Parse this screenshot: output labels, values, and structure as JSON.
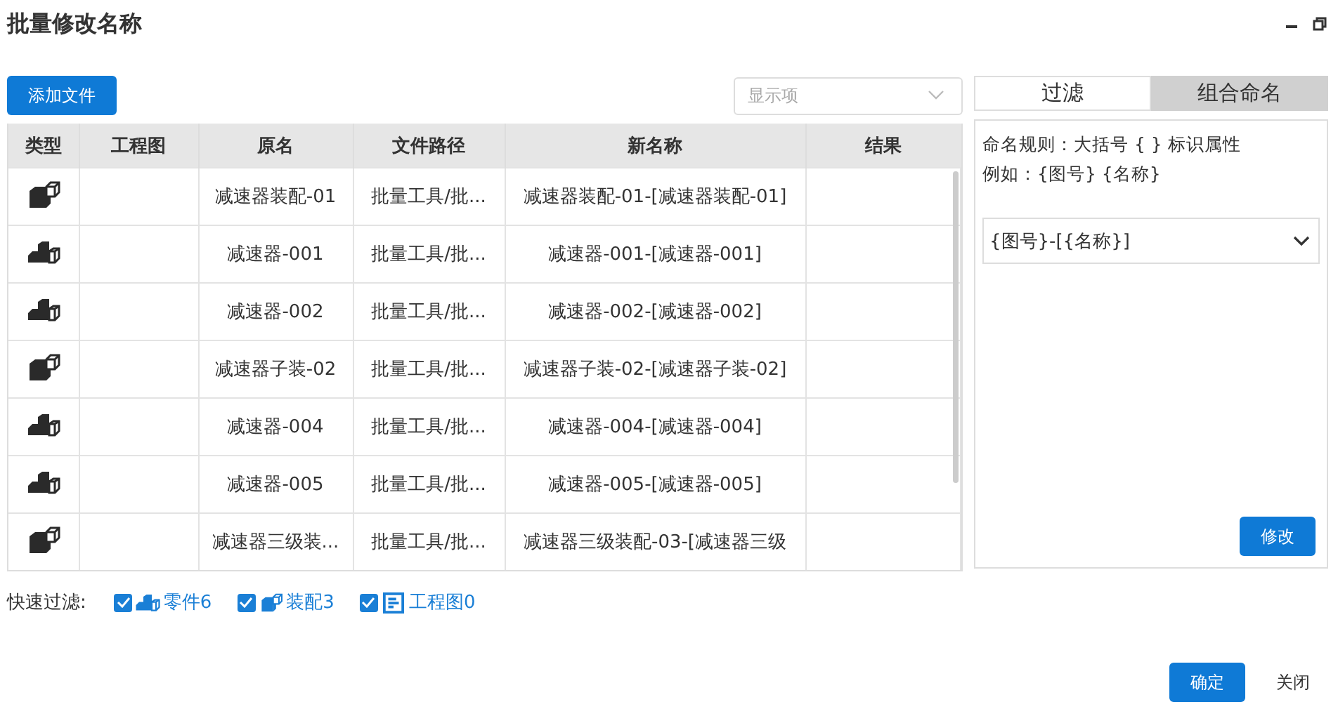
{
  "window": {
    "title": "批量修改名称"
  },
  "add_button": "添加文件",
  "display_select": {
    "placeholder": "显示项"
  },
  "table": {
    "columns": [
      "类型",
      "工程图",
      "原名",
      "文件路径",
      "新名称",
      "结果"
    ],
    "rows": [
      {
        "kind": "assembly",
        "original_name": "减速器装配-01",
        "path": "批量工具/批...",
        "new_name": "减速器装配-01-[减速器装配-01]"
      },
      {
        "kind": "part",
        "original_name": "减速器-001",
        "path": "批量工具/批...",
        "new_name": "减速器-001-[减速器-001]"
      },
      {
        "kind": "part",
        "original_name": "减速器-002",
        "path": "批量工具/批...",
        "new_name": "减速器-002-[减速器-002]"
      },
      {
        "kind": "assembly",
        "original_name": "减速器子装-02",
        "path": "批量工具/批...",
        "new_name": "减速器子装-02-[减速器子装-02]"
      },
      {
        "kind": "part",
        "original_name": "减速器-004",
        "path": "批量工具/批...",
        "new_name": "减速器-004-[减速器-004]"
      },
      {
        "kind": "part",
        "original_name": "减速器-005",
        "path": "批量工具/批...",
        "new_name": "减速器-005-[减速器-005]"
      },
      {
        "kind": "assembly",
        "original_name": "减速器三级装...",
        "path": "批量工具/批...",
        "new_name": "减速器三级装配-03-[减速器三级"
      }
    ]
  },
  "quick_filter": {
    "label": "快速过滤:",
    "items": [
      {
        "kind": "part",
        "label": "零件6",
        "checked": true
      },
      {
        "kind": "assembly",
        "label": "装配3",
        "checked": true
      },
      {
        "kind": "drawing",
        "label": "工程图0",
        "checked": true
      }
    ]
  },
  "tabs": [
    {
      "label": "过滤",
      "selected": false
    },
    {
      "label": "组合命名",
      "selected": true
    }
  ],
  "naming": {
    "rule": "命名规则：大括号 { } 标识属性",
    "example": "例如：{图号} {名称}",
    "pattern": "{图号}-[{名称}]",
    "apply_button": "修改"
  },
  "footer": {
    "ok": "确定",
    "close": "关闭"
  }
}
